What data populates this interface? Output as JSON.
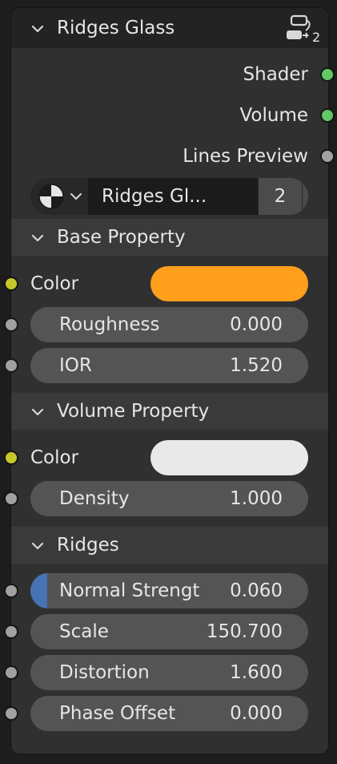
{
  "node": {
    "title": "Ridges Glass",
    "header_icon": "node-group-icon",
    "header_icon_count": "2"
  },
  "outputs": [
    {
      "label": "Shader",
      "socket_color": "#63c763"
    },
    {
      "label": "Volume",
      "socket_color": "#63c763"
    },
    {
      "label": "Lines Preview",
      "socket_color": "#a1a1a1"
    }
  ],
  "datablock": {
    "type_icon": "node-tree-icon",
    "name": "Ridges Gl...",
    "users": "2",
    "fake_user_icon": "shield-icon"
  },
  "panels": {
    "base": {
      "title": "Base Property",
      "color_label": "Color",
      "color_value": "#ff9f1c",
      "fields": [
        {
          "label": "Roughness",
          "value": "0.000"
        },
        {
          "label": "IOR",
          "value": "1.520"
        }
      ]
    },
    "volume": {
      "title": "Volume Property",
      "color_label": "Color",
      "color_value": "#e9e9e9",
      "fields": [
        {
          "label": "Density",
          "value": "1.000"
        }
      ]
    },
    "ridges": {
      "title": "Ridges",
      "fields": [
        {
          "label": "Normal Strengt",
          "value": "0.060",
          "fill_fraction": 0.06
        },
        {
          "label": "Scale",
          "value": "150.700"
        },
        {
          "label": "Distortion",
          "value": "1.600"
        },
        {
          "label": "Phase Offset",
          "value": "0.000"
        }
      ]
    }
  },
  "colors": {
    "node_body": "#303030",
    "node_header": "#232323",
    "field_bg": "#545454",
    "slider_fill": "#4772b3",
    "float_socket": "#a1a1a1",
    "color_socket": "#c7c729",
    "shader_socket": "#63c763"
  }
}
